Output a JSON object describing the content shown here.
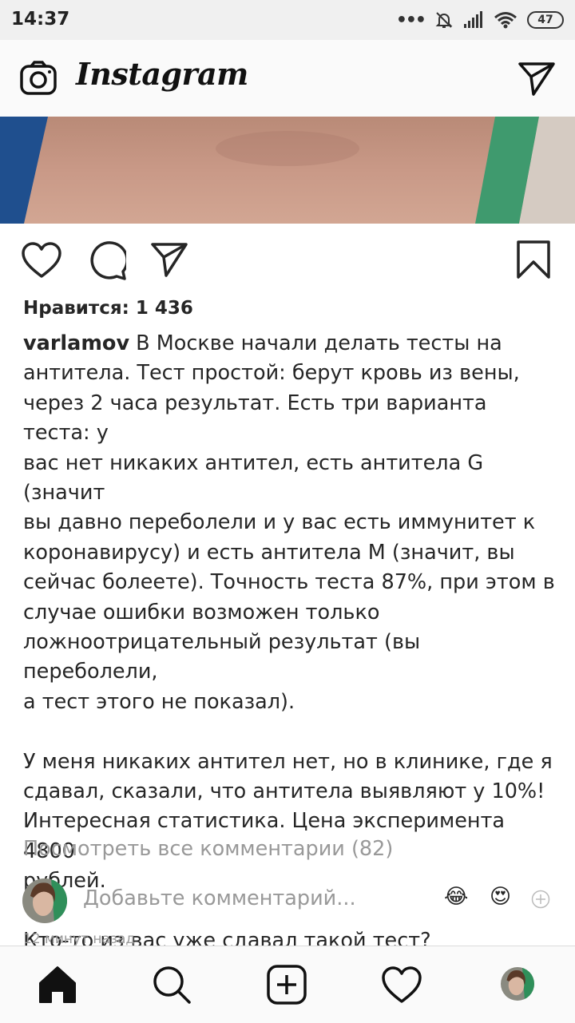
{
  "status_bar": {
    "time": "14:37",
    "battery": "47"
  },
  "app": {
    "title": "Instagram"
  },
  "post": {
    "likes": "Нравится: 1 436",
    "username": "varlamov",
    "caption_lines": [
      " В Москве начали делать тесты на",
      "антитела. Тест простой: берут кровь из вены,",
      "через 2 часа результат. Есть три варианта теста: у",
      "вас нет никаких антител, есть антитела G (значит",
      "вы давно переболели и у вас есть иммунитет к",
      "коронавирусу) и есть антитела М (значит, вы",
      "сейчас болеете). Точность теста 87%, при этом в",
      "случае ошибки возможен только",
      "ложноотрицательный результат (вы переболели,",
      "а тест этого не показал)."
    ],
    "paragraph2_lines": [
      "У меня никаких антител нет, но в клинике, где я",
      "сдавал, сказали, что антитела выявляют у 10%!",
      "Интересная статистика. Цена эксперимента 4800",
      "рублей."
    ],
    "paragraph3": "Кто-то из вас уже сдавал такой тест?",
    "view_comments": "Посмотреть все комментарии (82)",
    "comment_placeholder": "Добавьте комментарий...",
    "emoji_1": "😂",
    "emoji_2": "😍",
    "timestamp": "12 минут назад"
  },
  "colors": {
    "text": "#262626",
    "muted": "#999999",
    "status_bar_bg": "#f0f0f0",
    "header_bg": "#fafafa"
  },
  "icons": [
    "camera-icon",
    "direct-message-icon",
    "heart-icon",
    "comment-icon",
    "share-icon",
    "bookmark-icon",
    "home-icon",
    "search-icon",
    "add-post-icon",
    "activity-heart-icon"
  ]
}
